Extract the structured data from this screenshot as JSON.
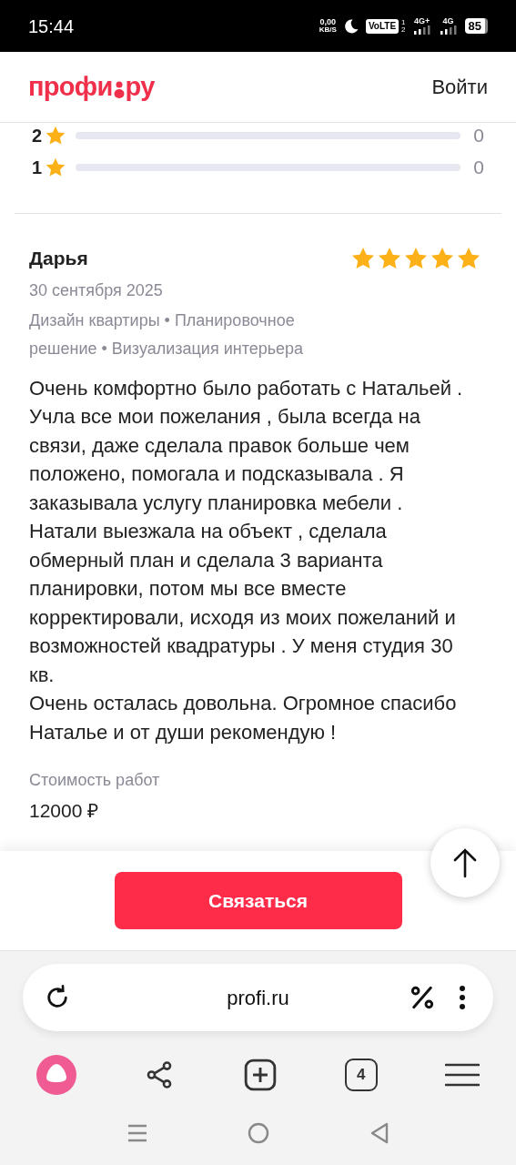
{
  "status_bar": {
    "time": "15:44",
    "speed": "0,00",
    "speed_unit": "KB/S",
    "volte": "VoLTE",
    "sim_1": "1",
    "sim_2": "2",
    "network_1": "4G+",
    "network_2": "4G",
    "battery": "85"
  },
  "header": {
    "logo_left": "профи",
    "logo_right": "ру",
    "login": "Войти"
  },
  "rating_rows": [
    {
      "label": "2",
      "level": 0,
      "count": "0"
    },
    {
      "label": "1",
      "level": 0,
      "count": "0"
    }
  ],
  "review": {
    "author": "Дарья",
    "stars": 5,
    "date": "30 сентября 2025",
    "services": "Дизайн квартиры • Планировочное решение • Визуализация интерьера",
    "text": "Очень комфортно было работать с Натальей . Учла все мои пожелания , была всегда на связи, даже сделала правок больше чем положено, помогала и подсказывала . Я заказывала услугу планировка мебели . Натали выезжала на объект , сделала обмерный план и сделала 3 варианта планировки, потом мы все вместе корректировали, исходя из моих пожеланий и возможностей квадратуры . У меня студия 30 кв.\nОчень осталась довольна. Огромное спасибо Наталье и от души рекомендую !",
    "cost_label": "Стоимость работ",
    "cost": "12000 ₽"
  },
  "contact_button": "Связаться",
  "browser": {
    "url": "profi.ru",
    "tabs_count": "4"
  }
}
